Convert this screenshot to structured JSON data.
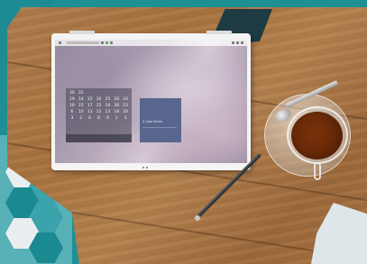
{
  "image": {
    "calendar_dates": [
      [
        "30",
        "31",
        "",
        "",
        "",
        "",
        ""
      ],
      [
        "19",
        "14",
        "15",
        "16",
        "25",
        "28",
        "24"
      ],
      [
        "19",
        "15",
        "17",
        "15",
        "18",
        "30",
        "23"
      ],
      [
        "6",
        "10",
        "11",
        "12",
        "13",
        "18",
        "20"
      ],
      [
        "3",
        "2",
        "6",
        "8",
        "9",
        "1",
        "3"
      ]
    ],
    "widget_text": "2 new items",
    "colors": {
      "table_wood": "#a9743f",
      "tile_teal": "#1d8b93",
      "laptop_shell": "#f4f4f4",
      "widget_blue": "#58668f",
      "tea": "#6a2a08"
    },
    "icons": [
      "laptop-icon",
      "tea-cup-icon",
      "pen-icon",
      "spoon-icon"
    ]
  }
}
